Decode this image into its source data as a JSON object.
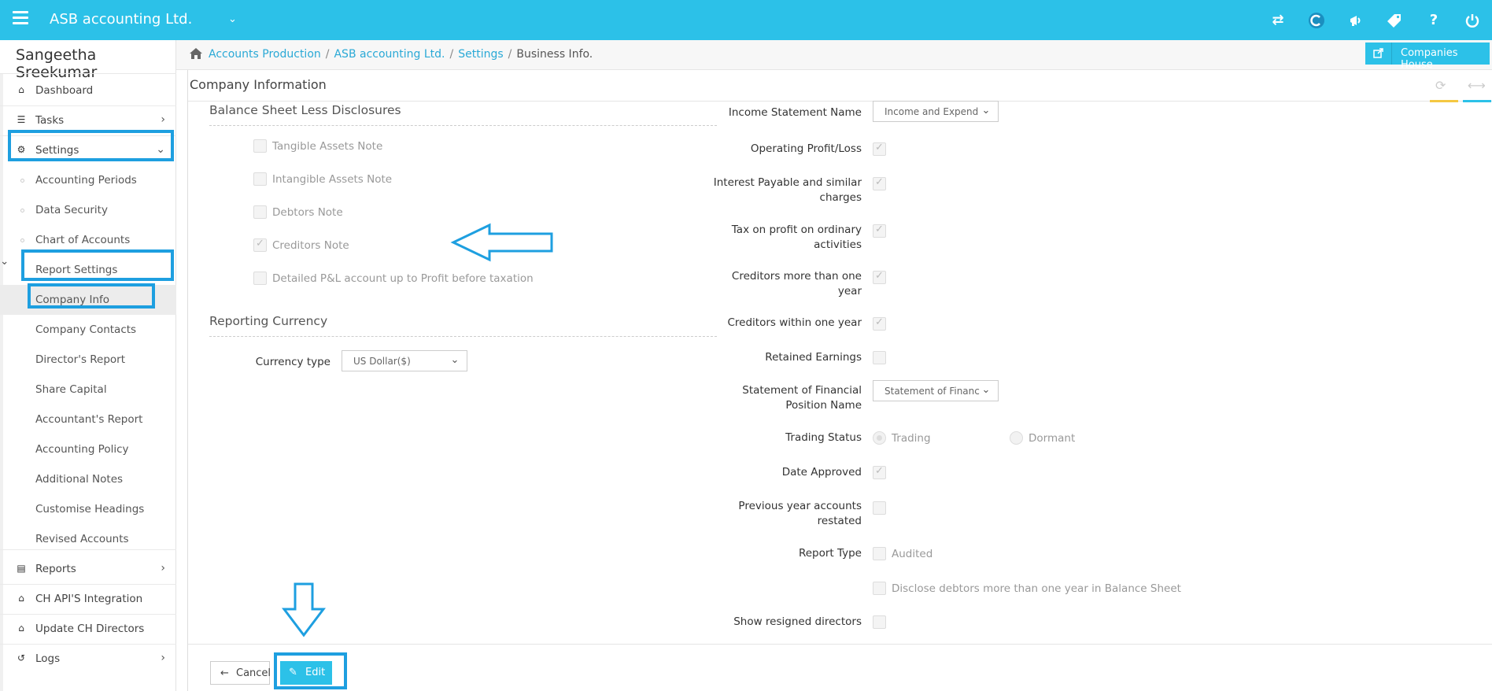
{
  "topbar": {
    "company_name": "ASB accounting Ltd.",
    "icons": [
      "transfer-icon",
      "c-logo-icon",
      "megaphone-icon",
      "tag-icon",
      "help-icon",
      "power-icon"
    ]
  },
  "sidebar": {
    "user_name": "Sangeetha Sreekumar",
    "items": {
      "dashboard": "Dashboard",
      "tasks": "Tasks",
      "settings": "Settings",
      "accounting_periods": "Accounting Periods",
      "data_security": "Data Security",
      "chart_of_accounts": "Chart of Accounts",
      "report_settings": "Report Settings",
      "company_info": "Company Info",
      "company_contacts": "Company Contacts",
      "directors_report": "Director's Report",
      "share_capital": "Share Capital",
      "accountants_report": "Accountant's Report",
      "accounting_policy": "Accounting Policy",
      "additional_notes": "Additional Notes",
      "customise_headings": "Customise Headings",
      "revised_accounts": "Revised Accounts",
      "reports": "Reports",
      "ch_api": "CH API'S Integration",
      "update_ch_directors": "Update CH Directors",
      "logs": "Logs"
    }
  },
  "breadcrumb": {
    "items": [
      "Accounts Production",
      "ASB accounting Ltd.",
      "Settings"
    ],
    "current": "Business Info.",
    "separator": "/"
  },
  "companies_house_button": "Companies House",
  "panel": {
    "title": "Company Information"
  },
  "left": {
    "section1_title": "Balance Sheet Less Disclosures",
    "checkboxes": [
      {
        "label": "Tangible Assets Note",
        "checked": false
      },
      {
        "label": "Intangible Assets Note",
        "checked": false
      },
      {
        "label": "Debtors Note",
        "checked": false
      },
      {
        "label": "Creditors Note",
        "checked": true
      },
      {
        "label": "Detailed P&L account up to Profit before taxation",
        "checked": false
      }
    ],
    "section2_title": "Reporting Currency",
    "currency_label": "Currency type",
    "currency_value": "US Dollar($)"
  },
  "right": {
    "income_statement_label": "Income Statement Name",
    "income_statement_value": "Income and Expend",
    "operating_profit_label": "Operating Profit/Loss",
    "interest_payable_label_1": "Interest Payable and similar",
    "interest_payable_label_2": "charges",
    "tax_profit_label_1": "Tax on profit on ordinary",
    "tax_profit_label_2": "activities",
    "creditors_more_label_1": "Creditors more than one",
    "creditors_more_label_2": "year",
    "creditors_within_label": "Creditors within one year",
    "retained_earnings_label": "Retained Earnings",
    "sofp_label_1": "Statement of Financial",
    "sofp_label_2": "Position Name",
    "sofp_value": "Statement of Financ",
    "trading_status_label": "Trading Status",
    "trading_option": "Trading",
    "dormant_option": "Dormant",
    "date_approved_label": "Date Approved",
    "prev_year_label_1": "Previous year accounts",
    "prev_year_label_2": "restated",
    "report_type_label": "Report Type",
    "audited_label": "Audited",
    "disclose_debtors_label": "Disclose debtors more than one year in Balance Sheet",
    "show_resigned_label": "Show resigned directors"
  },
  "footer": {
    "cancel_label": "Cancel",
    "edit_label": "Edit"
  },
  "colors": {
    "topbar": "#2cc1e8",
    "highlight": "#1e9fe0",
    "link": "#2aa9d6"
  }
}
